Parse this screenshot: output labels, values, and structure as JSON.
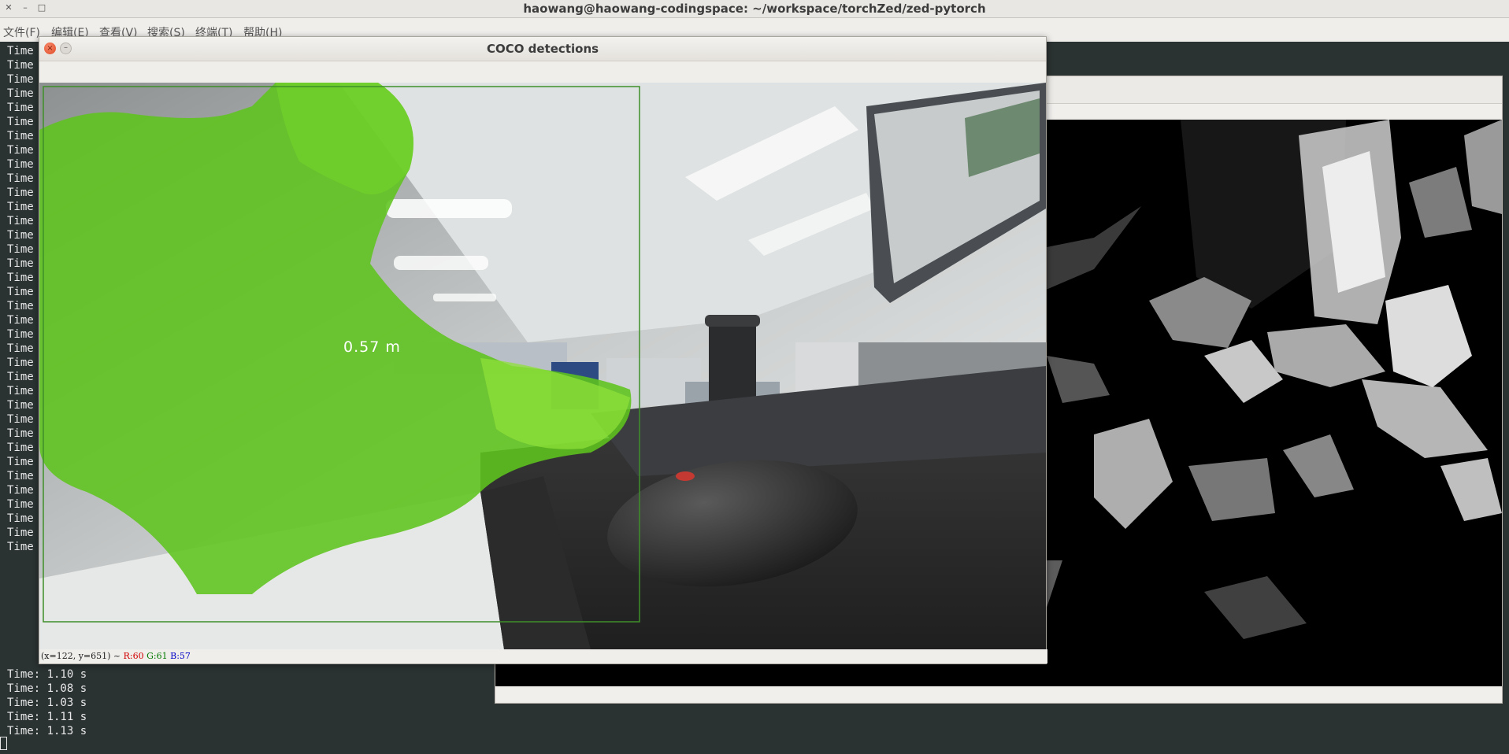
{
  "terminal": {
    "title": "haowang@haowang-codingspace: ~/workspace/torchZed/zed-pytorch",
    "menu": [
      "文件(F)",
      "编辑(E)",
      "查看(V)",
      "搜索(S)",
      "终端(T)",
      "帮助(H)"
    ],
    "hidden_line_prefix": "Time",
    "visible_lines": [
      "Time: 1.10 s",
      "Time: 1.08 s",
      "Time: 1.03 s",
      "Time: 1.11 s",
      "Time: 1.13 s"
    ],
    "window_buttons": [
      "✕",
      "–",
      "□"
    ]
  },
  "coco_window": {
    "title": "COCO detections",
    "close_glyph": "×",
    "minimize_glyph": "–",
    "detection_label": "0.57 m",
    "status": {
      "coords": "(x=122, y=651) ~",
      "r": "R:60",
      "g": "G:61",
      "b": "B:57"
    }
  },
  "colors": {
    "mask": "#5fc41c",
    "box": "#3f8f2a",
    "terminal_bg": "#2b3232"
  }
}
